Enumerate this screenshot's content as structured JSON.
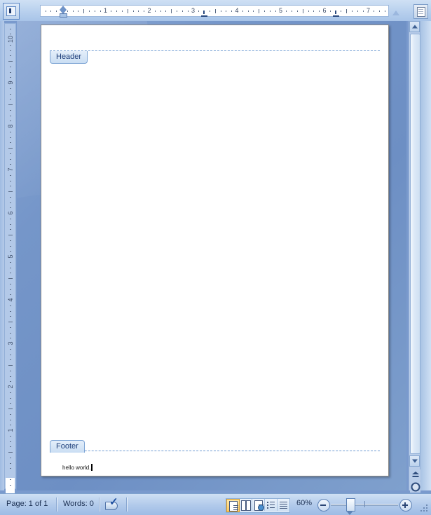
{
  "app": {
    "view_mode": "Print Layout",
    "background_color": "#6d8fc4"
  },
  "ruler_horizontal": {
    "unit": "inch",
    "numbers": [
      "1",
      "2",
      "3",
      "4",
      "5",
      "6",
      "7"
    ],
    "tab_stops": [
      "3.25",
      "6.25"
    ],
    "left_indent_marker": "first-line-indent-marker",
    "right_indent_marker": "right-indent-marker"
  },
  "ruler_vertical": {
    "unit": "inch",
    "numbers": [
      "10",
      "9",
      "8",
      "7",
      "6",
      "5",
      "4",
      "3",
      "2",
      "1"
    ]
  },
  "tab_selector": {
    "label": "left-tab-stop"
  },
  "view_ruler_button": {
    "label": "View Ruler"
  },
  "document": {
    "header": {
      "tab_label": "Header",
      "content": ""
    },
    "footer": {
      "tab_label": "Footer",
      "content": "hello world."
    }
  },
  "scrollbar": {
    "up_arrow": "scroll-up",
    "down_arrow": "scroll-down",
    "previous_page": "Previous Page",
    "select_browse_object": "Select Browse Object",
    "next_page": "Next Page"
  },
  "statusbar": {
    "page_label": "Page: 1 of 1",
    "words_label": "Words: 0",
    "proofing_icon": "spelling-and-grammar-check",
    "view_buttons": [
      {
        "name": "print-layout",
        "label": "Print Layout",
        "active": true
      },
      {
        "name": "full-screen-reading",
        "label": "Full Screen Reading",
        "active": false
      },
      {
        "name": "web-layout",
        "label": "Web Layout",
        "active": false
      },
      {
        "name": "outline",
        "label": "Outline",
        "active": false
      },
      {
        "name": "draft",
        "label": "Draft",
        "active": false
      }
    ],
    "zoom_level": "60%",
    "zoom_out_label": "Zoom Out",
    "zoom_in_label": "Zoom In"
  }
}
